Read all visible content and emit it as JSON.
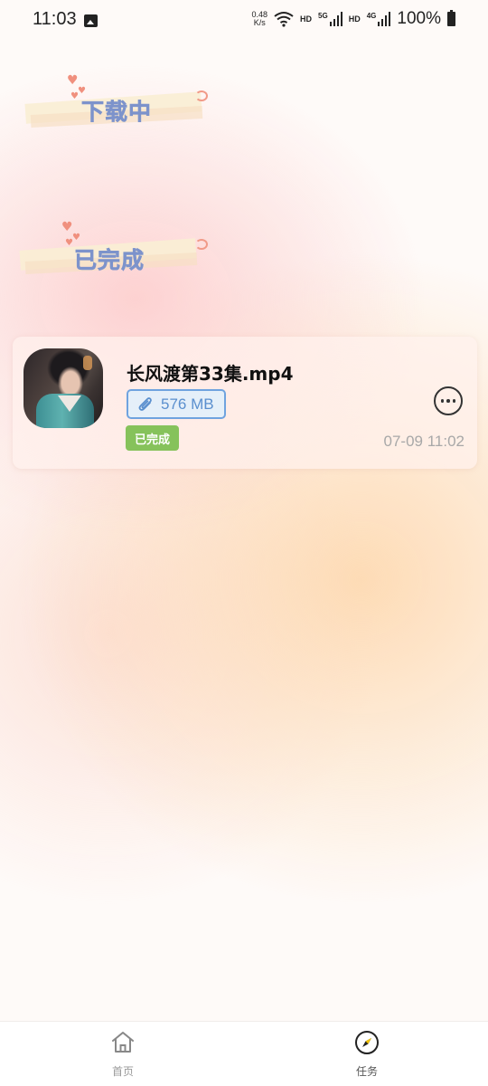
{
  "status_bar": {
    "time": "11:03",
    "net_speed_value": "0.48",
    "net_speed_unit": "K/s",
    "hd1": "HD",
    "net1": "5G",
    "hd2": "HD",
    "net2": "4G",
    "battery": "100%",
    "icons": [
      "gallery-icon",
      "wifi-icon",
      "signal-icon",
      "battery-icon"
    ]
  },
  "sections": {
    "downloading_title": "下载中",
    "completed_title": "已完成"
  },
  "downloads": [
    {
      "file_name": "长风渡第33集.mp4",
      "size": "576 MB",
      "status": "已完成",
      "date": "07-09 11:02"
    }
  ],
  "nav": {
    "home_label": "首页",
    "tasks_label": "任务"
  },
  "colors": {
    "title": "#7d93cb",
    "status_done": "#86c25b",
    "size_badge_border": "#6fa3df",
    "size_text": "#5a8fce"
  }
}
